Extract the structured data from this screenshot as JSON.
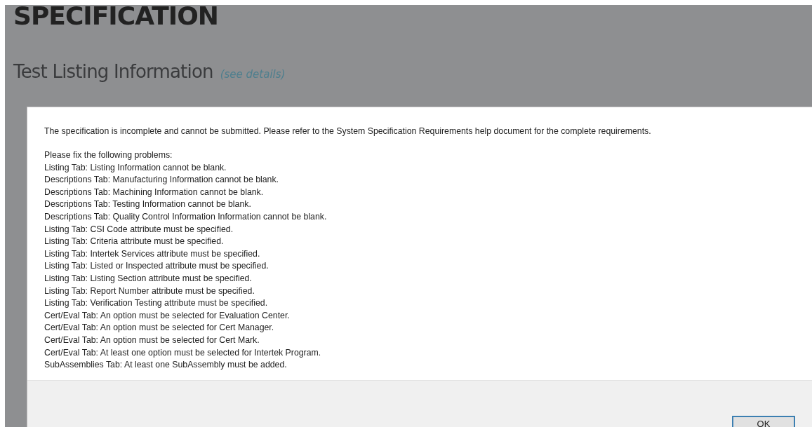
{
  "page": {
    "title": "SPECIFICATION",
    "section_title": "Test Listing Information",
    "details_link": "(see details)"
  },
  "dialog": {
    "message": "The specification is incomplete and cannot be submitted. Please refer to the System Specification Requirements help document for the complete requirements.",
    "problems_heading": "Please fix the following problems:",
    "problems": [
      "Listing Tab: Listing Information cannot be blank.",
      "Descriptions Tab: Manufacturing Information cannot be blank.",
      "Descriptions Tab: Machining Information cannot be blank.",
      "Descriptions Tab: Testing Information cannot be blank.",
      "Descriptions Tab: Quality Control Information Information cannot be blank.",
      "Listing Tab: CSI Code attribute must be specified.",
      "Listing Tab: Criteria attribute must be specified.",
      "Listing Tab: Intertek Services attribute must be specified.",
      "Listing Tab: Listed or Inspected attribute must be specified.",
      "Listing Tab: Listing Section attribute must be specified.",
      "Listing Tab: Report Number attribute must be specified.",
      "Listing Tab: Verification Testing attribute must be specified.",
      "Cert/Eval Tab: An option must be selected for Evaluation Center.",
      "Cert/Eval Tab: An option must be selected for Cert Manager.",
      "Cert/Eval Tab: An option must be selected for Cert Mark.",
      "Cert/Eval Tab: At least one option must be selected for Intertek Program.",
      "SubAssemblies Tab: At least one SubAssembly must be added."
    ],
    "buttons": [
      "OK"
    ]
  }
}
